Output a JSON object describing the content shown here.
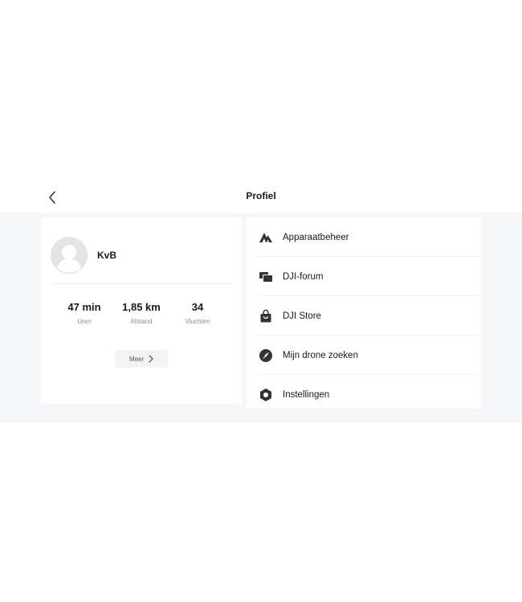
{
  "header": {
    "title": "Profiel"
  },
  "profile": {
    "username": "KvB",
    "stats": [
      {
        "value": "47 min",
        "label": "Uren"
      },
      {
        "value": "1,85 km",
        "label": "Afstand"
      },
      {
        "value": "34",
        "label": "Vluchten"
      }
    ],
    "more_label": "Meer"
  },
  "menu": {
    "items": [
      {
        "label": "Apparaatbeheer",
        "icon": "device-management-icon"
      },
      {
        "label": "DJI-forum",
        "icon": "forum-icon"
      },
      {
        "label": "DJI Store",
        "icon": "store-bag-icon"
      },
      {
        "label": "Mijn drone zoeken",
        "icon": "find-drone-icon"
      },
      {
        "label": "Instellingen",
        "icon": "settings-icon"
      }
    ]
  },
  "colors": {
    "background": "#f5f6f8",
    "card": "#ffffff",
    "text": "#1a1a1a",
    "muted": "#8a8a8a",
    "icon": "#333333"
  }
}
